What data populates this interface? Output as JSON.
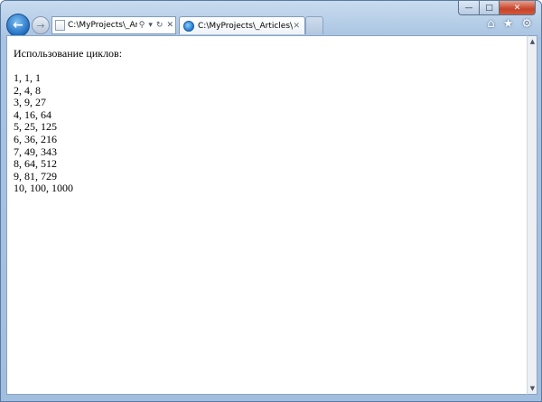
{
  "browser": {
    "address": "C:\\MyProjects\\_Art",
    "tab_title": "C:\\MyProjects\\_Articles\\Jav...",
    "caption": {
      "minimize": "—",
      "maximize": "□",
      "close": "✕"
    }
  },
  "page": {
    "heading": "Использование циклов:",
    "lines": [
      "1, 1, 1",
      "2, 4, 8",
      "3, 9, 27",
      "4, 16, 64",
      "5, 25, 125",
      "6, 36, 216",
      "7, 49, 343",
      "8, 64, 512",
      "9, 81, 729",
      "10, 100, 1000"
    ]
  },
  "icons": [
    "back-arrow-icon",
    "forward-arrow-icon",
    "search-icon",
    "refresh-icon",
    "home-icon",
    "favorites-star-icon",
    "settings-gear-icon"
  ]
}
